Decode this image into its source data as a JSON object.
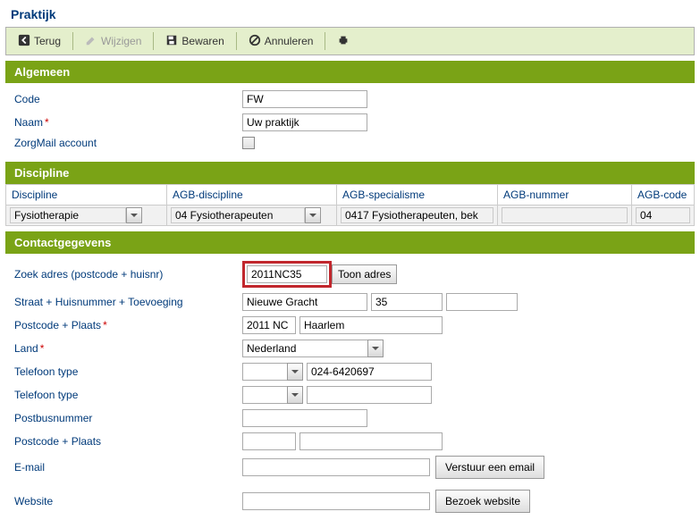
{
  "pageTitle": "Praktijk",
  "toolbar": {
    "back": "Terug",
    "edit": "Wijzigen",
    "save": "Bewaren",
    "cancel": "Annuleren"
  },
  "sections": {
    "algemeen": {
      "title": "Algemeen",
      "codeLabel": "Code",
      "codeValue": "FW",
      "naamLabel": "Naam",
      "naamValue": "Uw praktijk",
      "zorgmailLabel": "ZorgMail account",
      "zorgmailChecked": false
    },
    "discipline": {
      "title": "Discipline",
      "headers": {
        "discipline": "Discipline",
        "agbDiscipline": "AGB-discipline",
        "agbSpecialisme": "AGB-specialisme",
        "agbNummer": "AGB-nummer",
        "agbCode": "AGB-code"
      },
      "row": {
        "discipline": "Fysiotherapie",
        "agbDiscipline": "04 Fysiotherapeuten",
        "agbSpecialisme": "0417 Fysiotherapeuten, bek",
        "agbNummer": "",
        "agbCode": "04"
      }
    },
    "contact": {
      "title": "Contactgegevens",
      "zoekAdresLabel": "Zoek adres (postcode + huisnr)",
      "zoekAdresValue": "2011NC35",
      "toonAdresBtn": "Toon adres",
      "straatLabel": "Straat + Huisnummer + Toevoeging",
      "straatValue": "Nieuwe Gracht",
      "huisnrValue": "35",
      "toevoegingValue": "",
      "postcodePlaatsLabel": "Postcode + Plaats",
      "postcodeValue": "2011 NC",
      "plaatsValue": "Haarlem",
      "landLabel": "Land",
      "landValue": "Nederland",
      "telefoonLabel": "Telefoon type",
      "telefoon1Type": "",
      "telefoon1Value": "024-6420697",
      "telefoon2Type": "",
      "telefoon2Value": "",
      "postbusLabel": "Postbusnummer",
      "postbusValue": "",
      "postcodePlaats2Label": "Postcode + Plaats",
      "postcode2Value": "",
      "plaats2Value": "",
      "emailLabel": "E-mail",
      "emailValue": "",
      "verstuurEmailBtn": "Verstuur een email",
      "websiteLabel": "Website",
      "websiteValue": "",
      "bezoekWebsiteBtn": "Bezoek website"
    }
  }
}
